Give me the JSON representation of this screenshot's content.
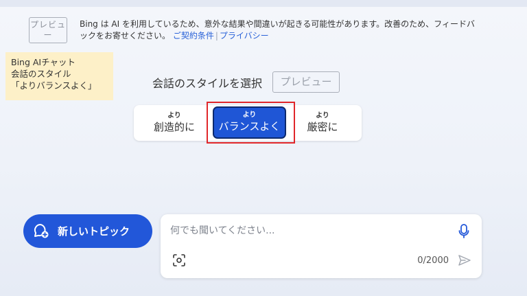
{
  "header": {
    "preview_badge": "プレビュー",
    "disclaimer_text": "Bing は AI を利用しているため、意外な結果や間違いが起きる可能性があります。改善のため、フィードバックをお寄せください。",
    "links": [
      "ご契約条件",
      "プライバシー"
    ]
  },
  "annotation": {
    "lines": [
      "Bing AIチャット",
      "会話のスタイル",
      "「よりバランスよく」"
    ]
  },
  "style_picker": {
    "heading": "会話のスタイルを選択",
    "preview_badge": "プレビュー",
    "options": [
      {
        "small": "より",
        "label": "創造的に",
        "selected": false
      },
      {
        "small": "より",
        "label": "バランスよく",
        "selected": true
      },
      {
        "small": "より",
        "label": "厳密に",
        "selected": false
      }
    ]
  },
  "composer": {
    "new_topic_label": "新しいトピック",
    "input_placeholder": "何でも聞いてください...",
    "char_counter": "0/2000"
  },
  "icons": {
    "new_topic": "chat-plus-icon",
    "mic": "microphone-icon",
    "scan": "visual-search-icon",
    "send": "send-icon"
  },
  "colors": {
    "accent": "#2257d9",
    "annotation_bg": "#fdf0c8",
    "highlight_border": "#e0262a"
  }
}
